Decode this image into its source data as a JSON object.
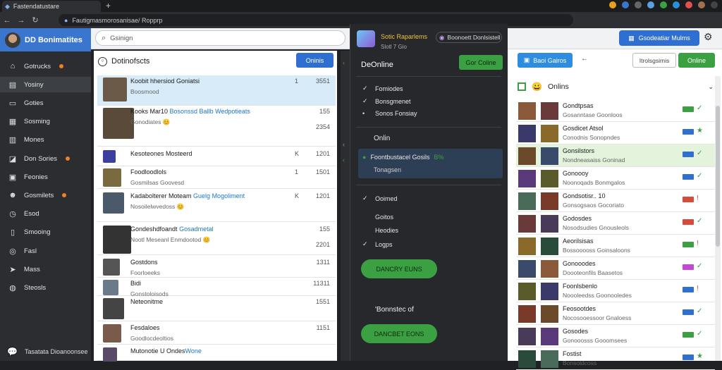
{
  "browser": {
    "tab_title": "Fastendatustare",
    "url": "Fautigmasmorosanisae/ Ropprp",
    "nav_back": "←",
    "nav_forward": "→",
    "nav_reload": "↻"
  },
  "sidebar": {
    "brand": "DD Bonimatites",
    "items": [
      {
        "label": "Gotrucks",
        "icon": "home-icon",
        "badge": true
      },
      {
        "label": "Yosiny",
        "icon": "clipboard-icon",
        "badge": false
      },
      {
        "label": "Goties",
        "icon": "folder-icon",
        "badge": false
      },
      {
        "label": "Sosming",
        "icon": "grid-icon",
        "badge": false
      },
      {
        "label": "Mones",
        "icon": "calendar-icon",
        "badge": false
      },
      {
        "label": "Don Sories",
        "icon": "tag-icon",
        "badge": true
      },
      {
        "label": "Feonies",
        "icon": "book-icon",
        "badge": false
      },
      {
        "label": "Gosmilets",
        "icon": "users-icon",
        "badge": true
      },
      {
        "label": "Esod",
        "icon": "clock-icon",
        "badge": false
      },
      {
        "label": "Smooing",
        "icon": "file-icon",
        "badge": false
      },
      {
        "label": "Fasl",
        "icon": "target-icon",
        "badge": false
      },
      {
        "label": "Mass",
        "icon": "send-icon",
        "badge": false
      },
      {
        "label": "Steosls",
        "icon": "globe-icon",
        "badge": false
      }
    ],
    "footer": "Tasatata Dioanoonsee"
  },
  "topbar": {
    "search_placeholder": "Gsinign",
    "right_button": "Gsodeatiar Mulms"
  },
  "list": {
    "header": "Dotinofscts",
    "button": "Oninis",
    "rows": [
      {
        "t1": "Koobit hhersiod Goniatsi",
        "t2": "Boosmood",
        "n": "1",
        "time": "3551",
        "time2": "",
        "selected": true
      },
      {
        "t1": "Kooks Mar10 ",
        "t1b": "Bosonssd Ballb Wedpotieats",
        "t2": "Gonodiates 😊",
        "n": "",
        "time": "155",
        "time2": "2354",
        "selected": false
      },
      {
        "t1": "Kesoteones Mosteerd",
        "t2": "",
        "n": "K",
        "time": "1201",
        "time2": "",
        "selected": false
      },
      {
        "t1": "Foodloodlols",
        "t2": "Gosmilsas Goovesd",
        "n": "1",
        "time": "1501",
        "time2": "",
        "selected": false
      },
      {
        "t1": "Kadabolterer Moteam ",
        "t1b": "Guelg Mogoliment",
        "t2": "Nosoilelwvedoss 😊",
        "n": "K",
        "time": "1201",
        "time2": "",
        "selected": false
      },
      {
        "t1": "Gondeshdfoandt ",
        "t1b": "Gosadmetal",
        "t2": "Nootl Meseanl Enmdootod 😊",
        "n": "",
        "time": "155",
        "time2": "2201",
        "selected": false
      },
      {
        "t1": "Gostdons",
        "t2": "Foorloeeks",
        "n": "",
        "time": "1311",
        "time2": "",
        "selected": false
      },
      {
        "t1": "Bidi",
        "t2": "Gonstoloisods",
        "n": "",
        "time": "11311",
        "time2": "",
        "selected": false
      },
      {
        "t1": "Neteonitme",
        "t2": "",
        "n": "",
        "time": "1551",
        "time2": "",
        "selected": false
      },
      {
        "t1": "Fesdaloes",
        "t2": "Goodlocdeoltios",
        "n": "",
        "time": "1151",
        "time2": "",
        "selected": false
      },
      {
        "t1": "Mutonotie U Ondes",
        "t1b": "Wone",
        "t2": "",
        "n": "",
        "time": "",
        "time2": "",
        "selected": false
      }
    ]
  },
  "popup": {
    "title_line1": "Sotic Raparlems",
    "title_line2": "Slotl 7 Gio",
    "chip": "Boonoett Donlsistell",
    "heading": "DeOnline",
    "button": "Gor Coline",
    "section1": [
      "Fomiodes",
      "Bonsgmenet",
      "Sonos Fonsiay"
    ],
    "section1_checks": [
      true,
      true,
      false
    ],
    "label_online": "Onlin",
    "highlight_line1": "Foontbustacel Gosils",
    "highlight_badge": "B%",
    "highlight_line2": "Tonagsen",
    "section2_title": "Ooimed",
    "section2": [
      "Goitos",
      "Heodies",
      "Logps"
    ],
    "section2_checks": [
      false,
      false,
      true
    ],
    "green_button1": "DANCRY EUNS",
    "mid_text": "'Bonnstec of",
    "green_button2": "DANCBET EONS"
  },
  "right": {
    "btn_blue": "Baoi Gairos",
    "btn_outline": "Itrolsgsimis",
    "btn_green": "Online",
    "header": "Onlins",
    "rows": [
      {
        "n1": "Gondtpsas",
        "n2": "Gosanntase Goonloos",
        "badge": "#3aa042",
        "status": "✓",
        "selected": false
      },
      {
        "n1": "Gosdicet Atsol",
        "n2": "Conodnis Sonopndes",
        "badge": "#2f6fd1",
        "status": "★",
        "selected": false
      },
      {
        "n1": "Gonsilstors",
        "n2": "Nondneasaiss Goninad",
        "badge": "#2f6fd1",
        "status": "✓",
        "selected": true
      },
      {
        "n1": "Gonoooy",
        "n2": "Noonoqads Bonmgalos",
        "badge": "#2f6fd1",
        "status": "✓",
        "selected": false
      },
      {
        "n1": "Gondsotisr.. 10",
        "n2": "Gonsogsaos Gocoriato",
        "badge": "#d84a3a",
        "status": "!",
        "selected": false
      },
      {
        "n1": "Godosdes",
        "n2": "Nosodsudies Gnousleols",
        "badge": "#d84a3a",
        "status": "✓",
        "selected": false
      },
      {
        "n1": "Aeorilsisas",
        "n2": "Bossooooss Goinsaloons",
        "badge": "#3aa042",
        "status": "!",
        "selected": false
      },
      {
        "n1": "Gonooodes",
        "n2": "Doooteonfils Baasetos",
        "badge": "#c24ad2",
        "status": "✓",
        "selected": false
      },
      {
        "n1": "Foonlsbenlo",
        "n2": "Noooleedss Goonooledes",
        "badge": "#2f6fd1",
        "status": "!",
        "selected": false
      },
      {
        "n1": "Feosootdes",
        "n2": "Nocosooessoor Gnaloess",
        "badge": "#2f6fd1",
        "status": "✓",
        "selected": false
      },
      {
        "n1": "Gosodes",
        "n2": "Gonooosss Gooomsees",
        "badge": "#3aa042",
        "status": "✓",
        "selected": false
      },
      {
        "n1": "Fostist",
        "n2": "Bonsoldcoss",
        "badge": "#2f6fd1",
        "status": "★",
        "selected": false
      }
    ]
  }
}
